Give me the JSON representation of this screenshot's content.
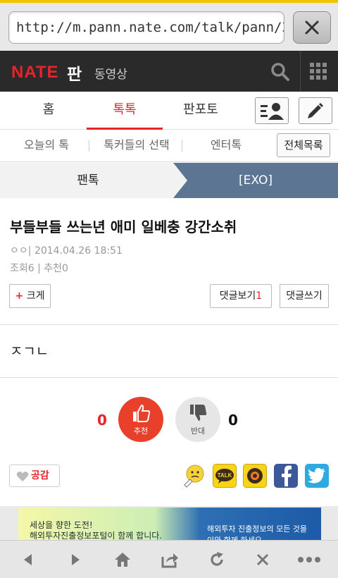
{
  "browser": {
    "url": "http://m.pann.nate.com/talk/pann/322",
    "close_icon": "close-icon"
  },
  "header": {
    "logo_nate": "NATE",
    "logo_pan": "판",
    "video_link": "동영상",
    "search_icon": "search-icon",
    "apps_icon": "grid-menu-icon"
  },
  "main_tabs": {
    "home": "홈",
    "talk": "톡톡",
    "panpoto": "판포토"
  },
  "sub_tabs": {
    "today": "오늘의 톡",
    "talkers": "톡커들의 선택",
    "entertain": "엔터톡",
    "all_list": "전체목록"
  },
  "category": {
    "left": "팬톡",
    "right": "[EXO]"
  },
  "post": {
    "title": "부들부들 쓰는년 애미 일베충 강간소취",
    "author": "ㅇㅇ",
    "meta_sep": "|",
    "date": "2014.04.26 18:51",
    "views": "조회6",
    "stats_sep": "|",
    "recommends": "추천0",
    "body": "ㅈㄱㄴ"
  },
  "buttons": {
    "enlarge": "크게",
    "view_comments": "댓글보기",
    "comment_count": "1",
    "write_comment": "댓글쓰기"
  },
  "vote": {
    "up_count": "0",
    "up_label": "추천",
    "down_count": "0",
    "down_label": "반대"
  },
  "share": {
    "sympathy": "공감",
    "kakao_talk": "TALK"
  },
  "ad": {
    "line1": "세상을 향한 도전!",
    "line2": "해외투자진출정보포털이 함께 합니다.",
    "right1": "해외투자 진출정보의 모든 것을",
    "right2": "이와 함께 하세요"
  },
  "colors": {
    "accent": "#e8242a",
    "category_bar": "#5b7593",
    "header_bg": "#2a2a2a"
  }
}
